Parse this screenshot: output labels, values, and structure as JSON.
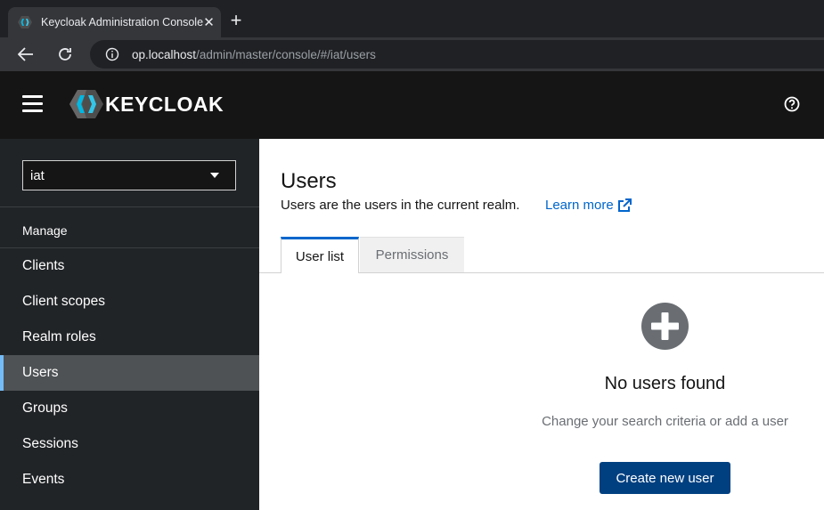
{
  "browser": {
    "tab_title": "Keycloak Administration Console",
    "close_glyph": "✕",
    "newtab_glyph": "+",
    "url_host": "op.localhost",
    "url_path": "/admin/master/console/#/iat/users"
  },
  "header": {
    "brand": "KEYCLOAK",
    "icons": [
      "hamburger-menu-icon",
      "help-icon"
    ]
  },
  "sidebar": {
    "realm_selector": {
      "value": "iat"
    },
    "section_title": "Manage",
    "items": [
      {
        "label": "Clients",
        "active": false
      },
      {
        "label": "Client scopes",
        "active": false
      },
      {
        "label": "Realm roles",
        "active": false
      },
      {
        "label": "Users",
        "active": true
      },
      {
        "label": "Groups",
        "active": false
      },
      {
        "label": "Sessions",
        "active": false
      },
      {
        "label": "Events",
        "active": false
      }
    ]
  },
  "main": {
    "title": "Users",
    "description": "Users are the users in the current realm.",
    "learn_more": "Learn more",
    "tabs": [
      {
        "label": "User list",
        "active": true
      },
      {
        "label": "Permissions",
        "active": false
      }
    ],
    "empty_state": {
      "title": "No users found",
      "body": "Change your search criteria or add a user",
      "button": "Create new user"
    }
  },
  "colors": {
    "header_bg": "#151515",
    "sidebar_bg": "#212427",
    "active_nav_bg": "#4f5255",
    "active_nav_accent": "#73bcf7",
    "link": "#0066cc",
    "primary_button": "#004080"
  }
}
